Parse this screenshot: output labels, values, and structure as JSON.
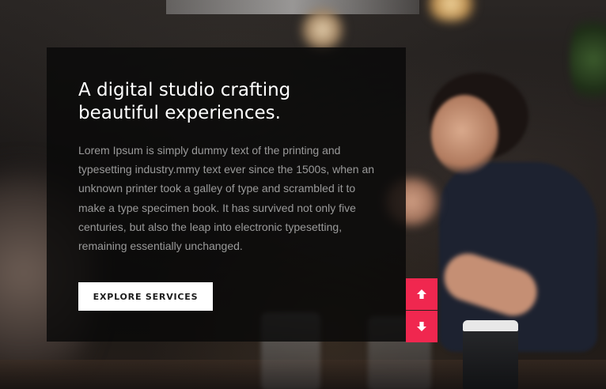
{
  "hero": {
    "headline_line1": "A digital studio crafting",
    "headline_line2": "beautiful experiences.",
    "description": "Lorem Ipsum is simply dummy text of the printing and typesetting industry.mmy text ever since the 1500s, when an unknown printer took a galley of type and scrambled it to make a type specimen book. It has survived not only five centuries, but also the leap into electronic typesetting, remaining essentially unchanged.",
    "cta_label": "EXPLORE SERVICES"
  },
  "slider_nav": {
    "prev_icon": "arrow-up-icon",
    "next_icon": "arrow-down-icon",
    "accent_color": "#f0274f"
  },
  "colors": {
    "panel_background": "#080808",
    "headline": "#ffffff",
    "description": "#9a9a9a",
    "cta_background": "#ffffff",
    "cta_text": "#1b1b1b"
  }
}
